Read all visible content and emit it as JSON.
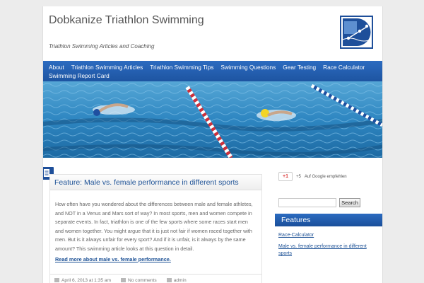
{
  "site": {
    "title": "Dobkanize Triathlon Swimming",
    "description": "Triathlon Swimming Articles and Coaching"
  },
  "nav": {
    "items": [
      {
        "label": "About"
      },
      {
        "label": "Triathlon Swimming Articles"
      },
      {
        "label": "Triathlon Swimming Tips"
      },
      {
        "label": "Swimming Questions"
      },
      {
        "label": "Gear Testing"
      },
      {
        "label": "Race Calculator"
      },
      {
        "label": "Swimming Report Card"
      }
    ]
  },
  "post": {
    "title": "Feature: Male vs. female performance in different sports",
    "body": "How often have you wondered about the differences between male and female athletes, and NOT in a Venus and Mars sort of way?  In most sports, men and women compete in separate events.  In fact, triathlon is one of the few sports where some races start men and women together.  You might argue that it is just not fair if women raced together with men.  But is it always unfair for every sport?  And if it is unfair, is it always by the same amount?  This swimming article looks at this question in detail.",
    "read_more": "Read more about male vs. female performance.",
    "meta": {
      "date": "April 6, 2013 at 1:35 am",
      "comments": "No comments",
      "author": "admin"
    }
  },
  "sidebar": {
    "gplus": {
      "label": "+1",
      "count": "+5",
      "text": "Auf Google empfehlen"
    },
    "search": {
      "button": "Search",
      "placeholder": ""
    },
    "features": {
      "title": "Features",
      "links": [
        {
          "label": "Race-Calculator"
        },
        {
          "label": "Male vs. female performance in different sports"
        }
      ]
    }
  },
  "colors": {
    "accent": "#1e4f9a",
    "link": "#1e5296",
    "pool": "#2a7fb8"
  }
}
